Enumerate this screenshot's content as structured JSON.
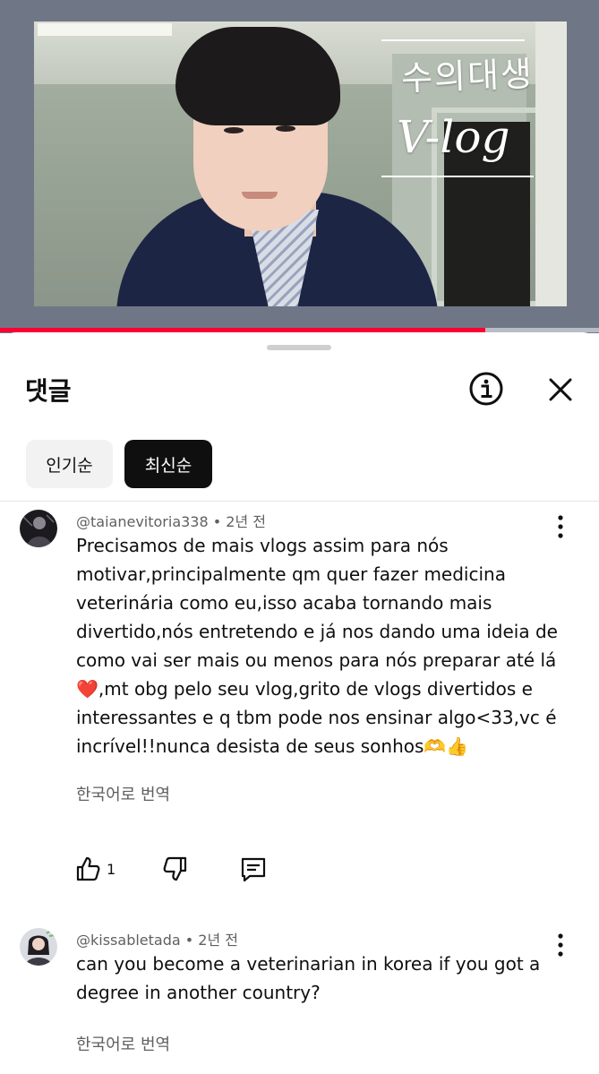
{
  "video": {
    "overlay_line1": "수의대생",
    "overlay_line2": "V-log",
    "progress_fraction": 0.81,
    "progress_color": "#ff0033"
  },
  "comments_sheet": {
    "title": "댓글",
    "info_icon": "info-circle-icon",
    "close_icon": "close-x-icon",
    "sort_chips": [
      {
        "label": "인기순",
        "selected": false
      },
      {
        "label": "최신순",
        "selected": true
      }
    ]
  },
  "comments": [
    {
      "handle": "@taianevitoria338",
      "separator": "•",
      "time": "2년 전",
      "lines": [
        "Precisamos de mais vlogs assim para nós",
        "motivar,principalmente qm quer fazer medicina",
        "veterinária como eu,isso acaba tornando mais",
        "divertido,nós entretendo e já nos dando uma ideia de",
        "como vai ser mais ou menos para nós preparar até lá",
        "❤️,mt obg pelo seu vlog,grito de vlogs divertidos e",
        "interessantes e q tbm pode nos ensinar algo<33,vc é",
        "incrível!!nunca desista de seus sonhos🫶👍"
      ],
      "translate_label": "한국어로 번역",
      "like_count": "1",
      "icons": [
        "thumbs-up-icon",
        "thumbs-down-icon",
        "reply-comment-icon",
        "more-vertical-icon"
      ]
    },
    {
      "handle": "@kissabletada",
      "separator": "•",
      "time": "2년 전",
      "lines": [
        "can you become a veterinarian in korea if you got a",
        "degree in another country?"
      ],
      "translate_label": "한국어로 번역",
      "icons": [
        "more-vertical-icon"
      ]
    }
  ]
}
